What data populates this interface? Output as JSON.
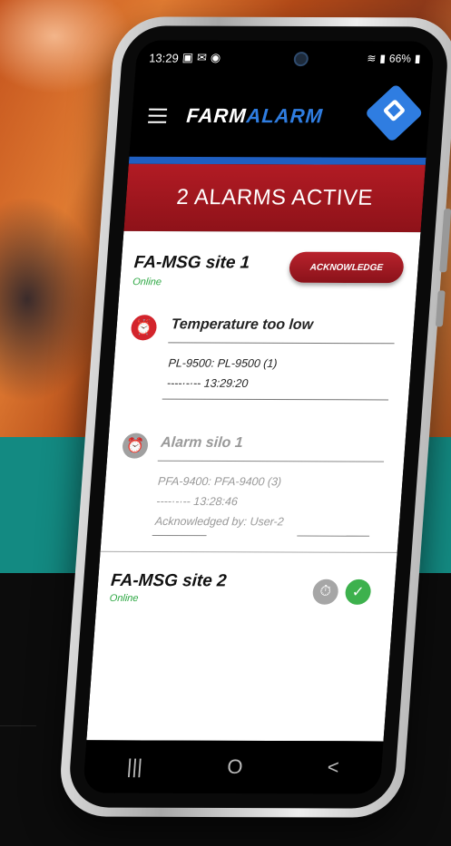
{
  "status_bar": {
    "time": "13:29",
    "notification_icons": [
      "image-icon",
      "gmail-icon",
      "messenger-icon"
    ],
    "battery": "66%"
  },
  "app": {
    "logo_part1": "FARM",
    "logo_part2": "ALARM",
    "menu_icon": "hamburger-icon",
    "brand_icon": "farmalarm-logo-icon"
  },
  "banner": {
    "text": "2 ALARMS ACTIVE"
  },
  "sites": [
    {
      "name": "FA-MSG site 1",
      "status": "Online",
      "acknowledge_label": "ACKNOWLEDGE",
      "alarms": [
        {
          "title": "Temperature too low",
          "device": "PL-9500: PL-9500 (1)",
          "time": "----·-·-- 13:29:20",
          "icon": "alarm-clock-icon",
          "color": "#d3242c"
        },
        {
          "title": "Alarm silo 1",
          "device": "PFA-9400: PFA-9400 (3)",
          "time": "----·-·-- 13:28:46",
          "acknowledged_by": "Acknowledged by: User-2",
          "icon": "alarm-clock-icon",
          "color": "#a0a0a0"
        }
      ]
    },
    {
      "name": "FA-MSG site 2",
      "status": "Online",
      "icons": [
        "clock-icon",
        "check-icon"
      ]
    }
  ],
  "colors": {
    "alarm_red": "#b21b24",
    "accent_blue": "#2f7de1",
    "online_green": "#2aa640",
    "ok_green": "#3db14d"
  },
  "navbar": {
    "recent": "|||",
    "home": "O",
    "back": "<"
  }
}
